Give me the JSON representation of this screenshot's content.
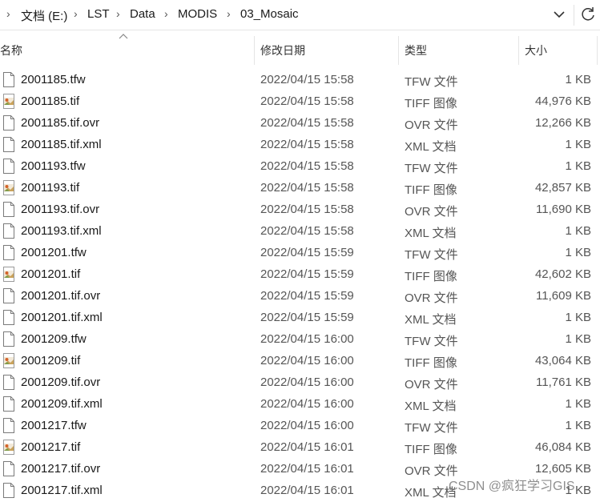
{
  "address_bar": {
    "segments": [
      "文档 (E:)",
      "LST",
      "Data",
      "MODIS",
      "03_Mosaic"
    ]
  },
  "columns": {
    "name": "名称",
    "date": "修改日期",
    "type": "类型",
    "size": "大小",
    "sorted_by": "name",
    "sort_direction": "ascending"
  },
  "files": [
    {
      "name": "2001185.tfw",
      "date": "2022/04/15 15:58",
      "type": "TFW 文件",
      "size": "1 KB",
      "icon": "blank-file-icon"
    },
    {
      "name": "2001185.tif",
      "date": "2022/04/15 15:58",
      "type": "TIFF 图像",
      "size": "44,976 KB",
      "icon": "tiff-image-icon"
    },
    {
      "name": "2001185.tif.ovr",
      "date": "2022/04/15 15:58",
      "type": "OVR 文件",
      "size": "12,266 KB",
      "icon": "blank-file-icon"
    },
    {
      "name": "2001185.tif.xml",
      "date": "2022/04/15 15:58",
      "type": "XML 文档",
      "size": "1 KB",
      "icon": "blank-file-icon"
    },
    {
      "name": "2001193.tfw",
      "date": "2022/04/15 15:58",
      "type": "TFW 文件",
      "size": "1 KB",
      "icon": "blank-file-icon"
    },
    {
      "name": "2001193.tif",
      "date": "2022/04/15 15:58",
      "type": "TIFF 图像",
      "size": "42,857 KB",
      "icon": "tiff-image-icon"
    },
    {
      "name": "2001193.tif.ovr",
      "date": "2022/04/15 15:58",
      "type": "OVR 文件",
      "size": "11,690 KB",
      "icon": "blank-file-icon"
    },
    {
      "name": "2001193.tif.xml",
      "date": "2022/04/15 15:58",
      "type": "XML 文档",
      "size": "1 KB",
      "icon": "blank-file-icon"
    },
    {
      "name": "2001201.tfw",
      "date": "2022/04/15 15:59",
      "type": "TFW 文件",
      "size": "1 KB",
      "icon": "blank-file-icon"
    },
    {
      "name": "2001201.tif",
      "date": "2022/04/15 15:59",
      "type": "TIFF 图像",
      "size": "42,602 KB",
      "icon": "tiff-image-icon"
    },
    {
      "name": "2001201.tif.ovr",
      "date": "2022/04/15 15:59",
      "type": "OVR 文件",
      "size": "11,609 KB",
      "icon": "blank-file-icon"
    },
    {
      "name": "2001201.tif.xml",
      "date": "2022/04/15 15:59",
      "type": "XML 文档",
      "size": "1 KB",
      "icon": "blank-file-icon"
    },
    {
      "name": "2001209.tfw",
      "date": "2022/04/15 16:00",
      "type": "TFW 文件",
      "size": "1 KB",
      "icon": "blank-file-icon"
    },
    {
      "name": "2001209.tif",
      "date": "2022/04/15 16:00",
      "type": "TIFF 图像",
      "size": "43,064 KB",
      "icon": "tiff-image-icon"
    },
    {
      "name": "2001209.tif.ovr",
      "date": "2022/04/15 16:00",
      "type": "OVR 文件",
      "size": "11,761 KB",
      "icon": "blank-file-icon"
    },
    {
      "name": "2001209.tif.xml",
      "date": "2022/04/15 16:00",
      "type": "XML 文档",
      "size": "1 KB",
      "icon": "blank-file-icon"
    },
    {
      "name": "2001217.tfw",
      "date": "2022/04/15 16:00",
      "type": "TFW 文件",
      "size": "1 KB",
      "icon": "blank-file-icon"
    },
    {
      "name": "2001217.tif",
      "date": "2022/04/15 16:01",
      "type": "TIFF 图像",
      "size": "46,084 KB",
      "icon": "tiff-image-icon"
    },
    {
      "name": "2001217.tif.ovr",
      "date": "2022/04/15 16:01",
      "type": "OVR 文件",
      "size": "12,605 KB",
      "icon": "blank-file-icon"
    },
    {
      "name": "2001217.tif.xml",
      "date": "2022/04/15 16:01",
      "type": "XML 文档",
      "size": "1 KB",
      "icon": "blank-file-icon"
    }
  ],
  "watermark": "CSDN @疯狂学习GIS",
  "colors": {
    "text": "#1a1a1a",
    "secondary_text": "#555555",
    "divider": "#e5e5e5",
    "tiff_icon_accent": "#d4622a"
  }
}
